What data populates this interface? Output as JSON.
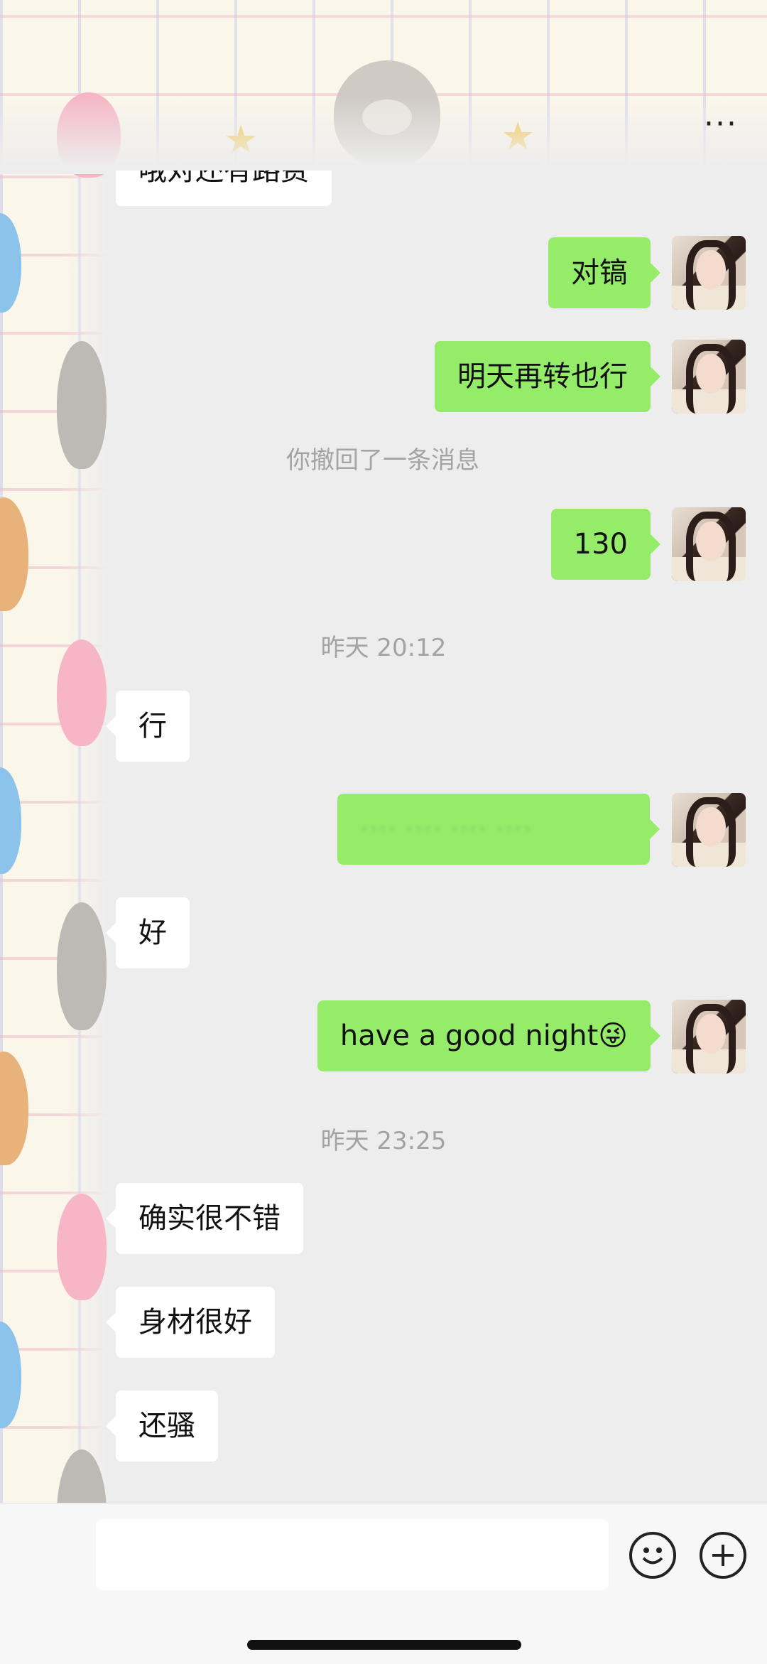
{
  "header": {
    "more_label": "···"
  },
  "messages": {
    "partial_top": "哦对还有路费",
    "m1": "对镐",
    "m2": "明天再转也行",
    "recall_notice": "你撤回了一条消息",
    "m3": "130",
    "time1": "昨天 20:12",
    "m4": "行",
    "m5_blurred": "···· ···· ···· ····",
    "m6": "好",
    "m7": "have a good night😜",
    "time2": "昨天 23:25",
    "m8": "确实很不错",
    "m9": "身材很好",
    "m10": "还骚"
  },
  "input": {
    "value": ""
  },
  "colors": {
    "outgoing_bubble": "#95ec69",
    "incoming_bubble": "#ffffff",
    "background": "#ededed"
  },
  "icons": {
    "emoji_button": "emoji-face-icon",
    "more_button": "plus-circle-icon"
  }
}
